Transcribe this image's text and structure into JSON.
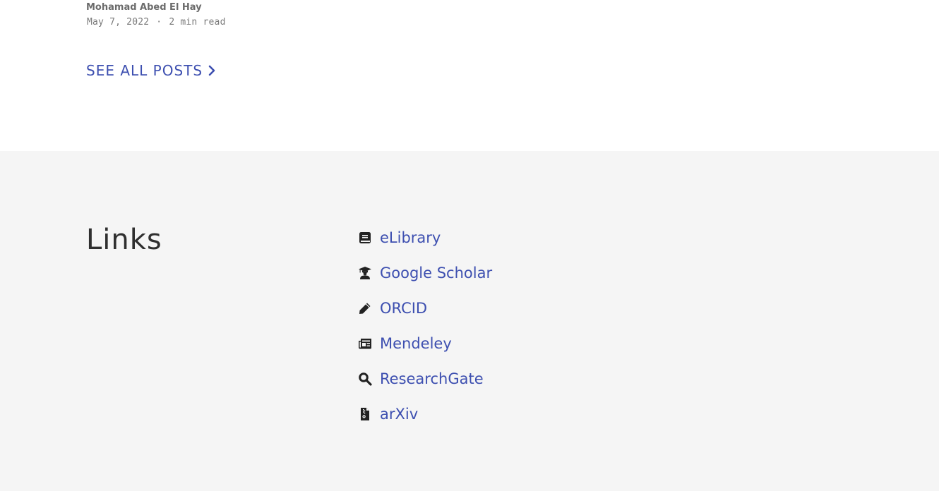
{
  "post": {
    "author": "Mohamad Abed El Hay",
    "date": "May 7, 2022",
    "separator": "·",
    "read_time": "2 min read"
  },
  "see_all": {
    "label": "SEE ALL POSTS",
    "icon": "chevron-right-icon"
  },
  "links": {
    "title": "Links",
    "items": [
      {
        "label": "eLibrary",
        "icon": "book-icon"
      },
      {
        "label": "Google Scholar",
        "icon": "graduate-icon"
      },
      {
        "label": "ORCID",
        "icon": "pencil-icon"
      },
      {
        "label": "Mendeley",
        "icon": "newspaper-icon"
      },
      {
        "label": "ResearchGate",
        "icon": "search-icon"
      },
      {
        "label": "arXiv",
        "icon": "file-archive-icon"
      }
    ]
  },
  "colors": {
    "link": "#3d4fb0",
    "section_bg": "#f5f5f5",
    "icon": "#222222"
  }
}
